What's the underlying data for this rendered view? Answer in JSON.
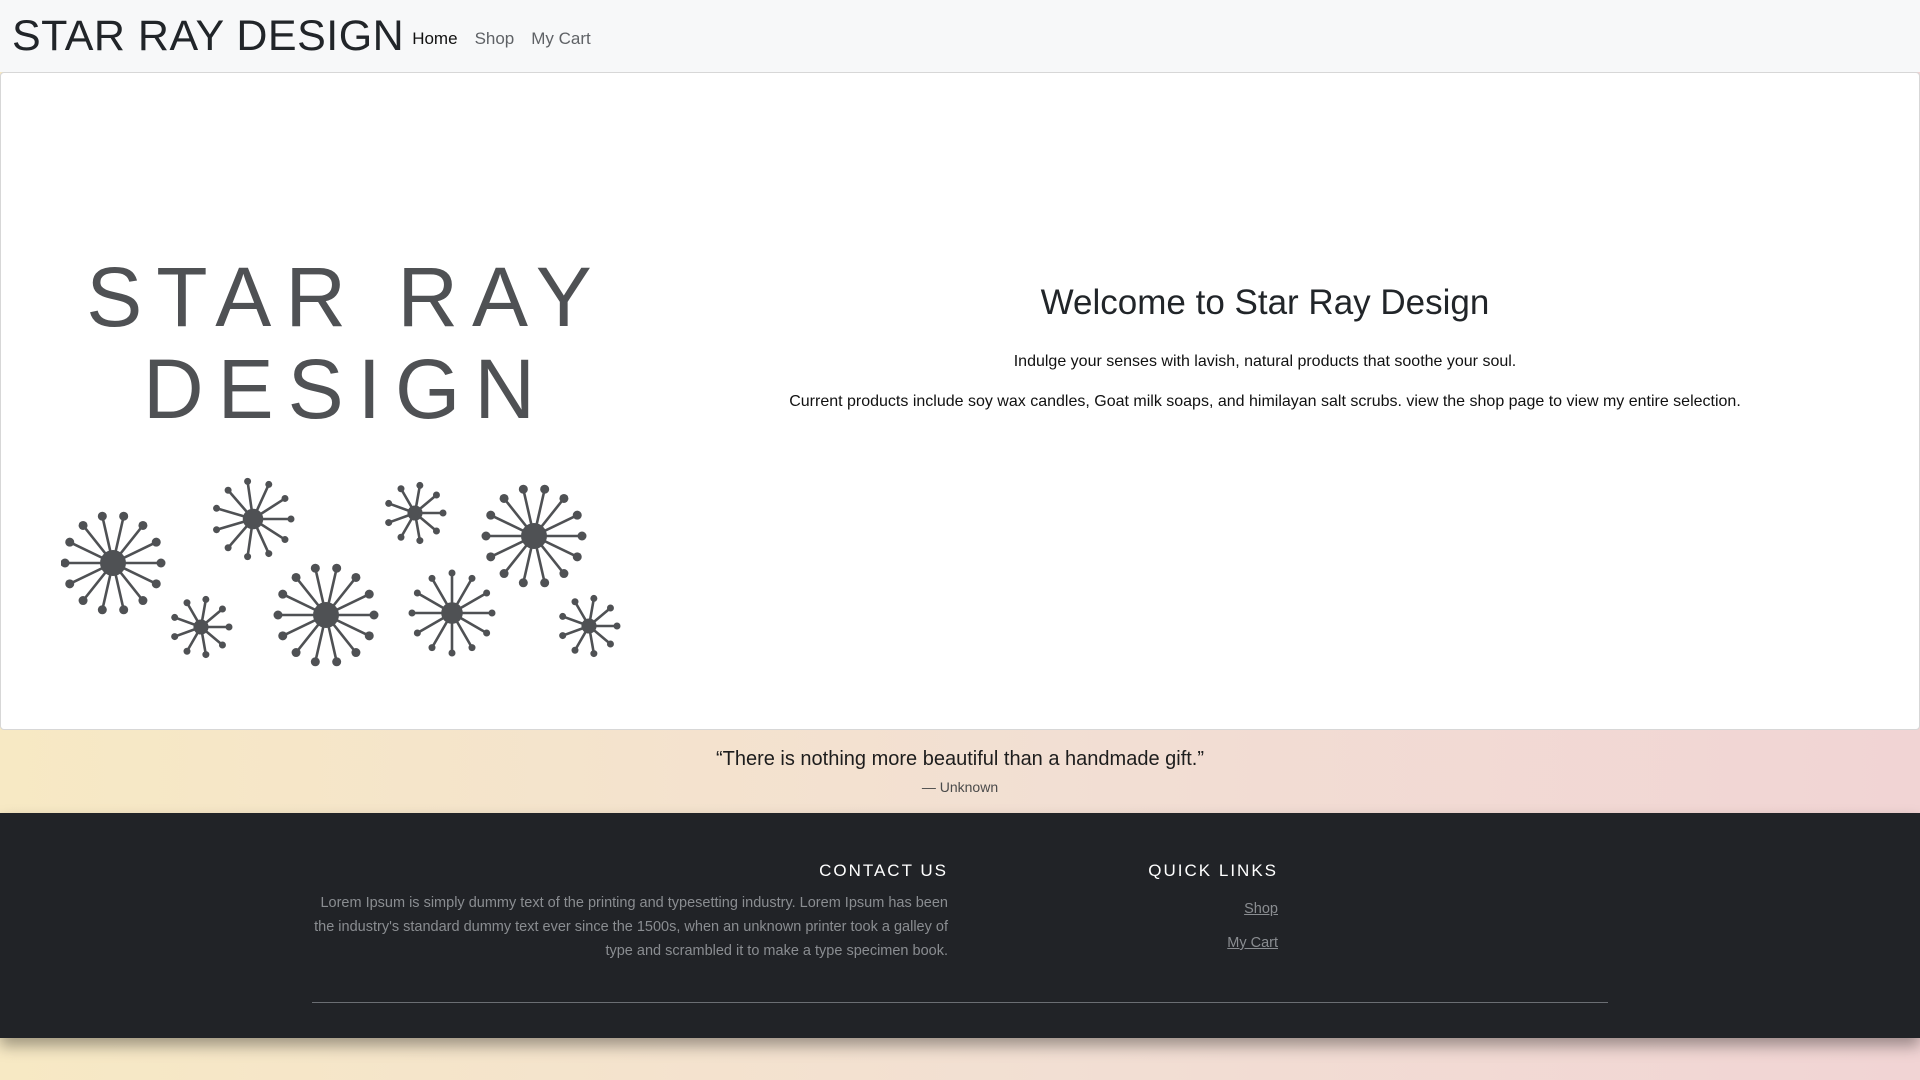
{
  "navbar": {
    "brand": "STAR RAY DESIGN",
    "links": [
      {
        "label": "Home",
        "active": true
      },
      {
        "label": "Shop",
        "active": false
      },
      {
        "label": "My Cart",
        "active": false
      }
    ]
  },
  "hero": {
    "logo": {
      "line1": "STAR RAY",
      "line2": "DESIGN",
      "color": "#4f5154"
    },
    "title": "Welcome to Star Ray Design",
    "paragraph1": "Indulge your senses with lavish, natural products that soothe your soul.",
    "paragraph2": "Current products include soy wax candles, Goat milk soaps, and himilayan salt scrubs. view the shop page to view my entire selection."
  },
  "quote": {
    "text": "“There is nothing more beautiful than a handmade gift.”",
    "author": "—  Unknown"
  },
  "footer": {
    "contact_heading": "CONTACT US",
    "contact_text": "Lorem Ipsum is simply dummy text of the printing and typesetting industry. Lorem Ipsum has been the industry's standard dummy text ever since the 1500s, when an unknown printer took a galley of type and scrambled it to make a type specimen book.",
    "links_heading": "QUICK LINKS",
    "links": [
      {
        "label": "Shop"
      },
      {
        "label": "My Cart"
      }
    ]
  },
  "colors": {
    "footer_bg": "#212327",
    "navbar_bg": "#f7f8f9",
    "gradient_start": "#f7e9c4",
    "gradient_end": "#f1d4d4"
  }
}
